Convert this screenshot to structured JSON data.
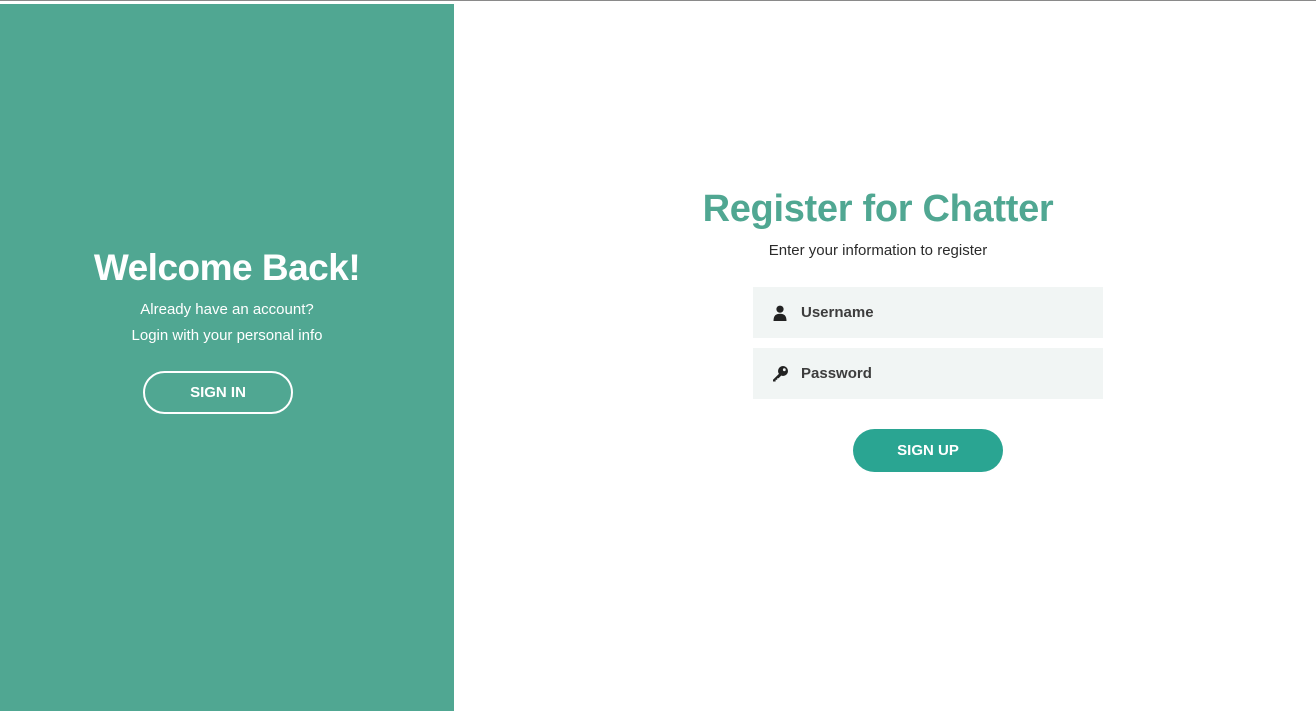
{
  "left_panel": {
    "title": "Welcome Back!",
    "line1": "Already have an account?",
    "line2": "Login with your personal info",
    "signin_label": "SIGN IN"
  },
  "register_form": {
    "title": "Register for Chatter",
    "subtitle": "Enter your information to register",
    "username": {
      "placeholder": "Username",
      "value": "",
      "icon": "user-icon"
    },
    "password": {
      "placeholder": "Password",
      "value": "",
      "icon": "key-icon"
    },
    "signup_label": "SIGN UP"
  },
  "colors": {
    "panel_green": "#50a792",
    "title_green": "#50a792",
    "button_teal": "#2aa592",
    "field_bg": "#f1f5f4",
    "text_dark": "#2b2b2b"
  }
}
